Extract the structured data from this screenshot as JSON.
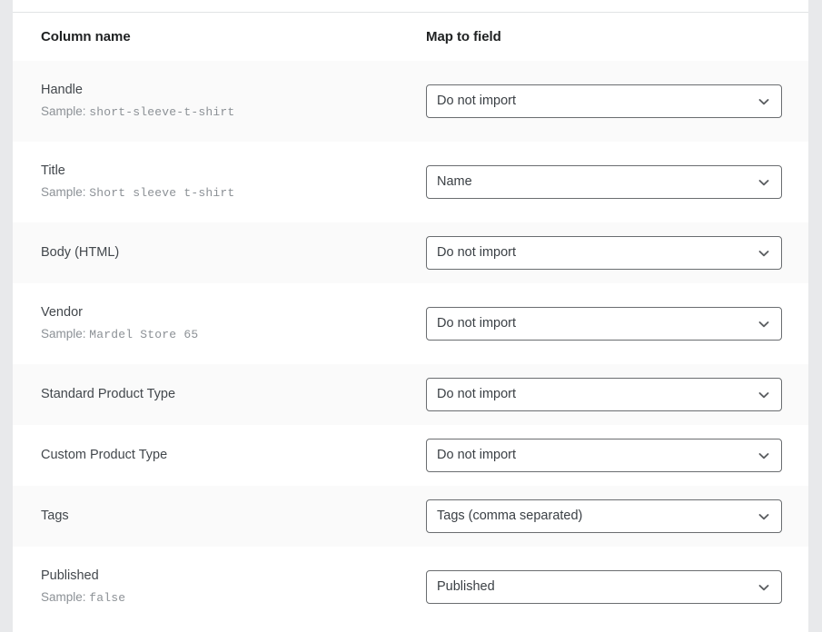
{
  "table": {
    "headers": {
      "column_name": "Column name",
      "map_to_field": "Map to field"
    },
    "sample_prefix": "Sample:",
    "rows": [
      {
        "column_name": "Handle",
        "sample": "short-sleeve-t-shirt",
        "mapped_field": "Do not import"
      },
      {
        "column_name": "Title",
        "sample": "Short sleeve t-shirt",
        "mapped_field": "Name"
      },
      {
        "column_name": "Body (HTML)",
        "sample": "",
        "mapped_field": "Do not import"
      },
      {
        "column_name": "Vendor",
        "sample": "Mardel Store 65",
        "mapped_field": "Do not import"
      },
      {
        "column_name": "Standard Product Type",
        "sample": "",
        "mapped_field": "Do not import"
      },
      {
        "column_name": "Custom Product Type",
        "sample": "",
        "mapped_field": "Do not import"
      },
      {
        "column_name": "Tags",
        "sample": "",
        "mapped_field": "Tags (comma separated)"
      },
      {
        "column_name": "Published",
        "sample": "false",
        "mapped_field": "Published"
      }
    ]
  },
  "icons": {
    "chevron_down": "chevron-down-icon"
  },
  "colors": {
    "page_background": "#e6e7e9",
    "card_background": "#ffffff",
    "row_shaded": "#fafafa",
    "header_text": "#202223",
    "label_text": "#42474c",
    "sample_text": "#8c9196",
    "select_border": "#6a6d70",
    "divider": "#e1e3e5"
  }
}
